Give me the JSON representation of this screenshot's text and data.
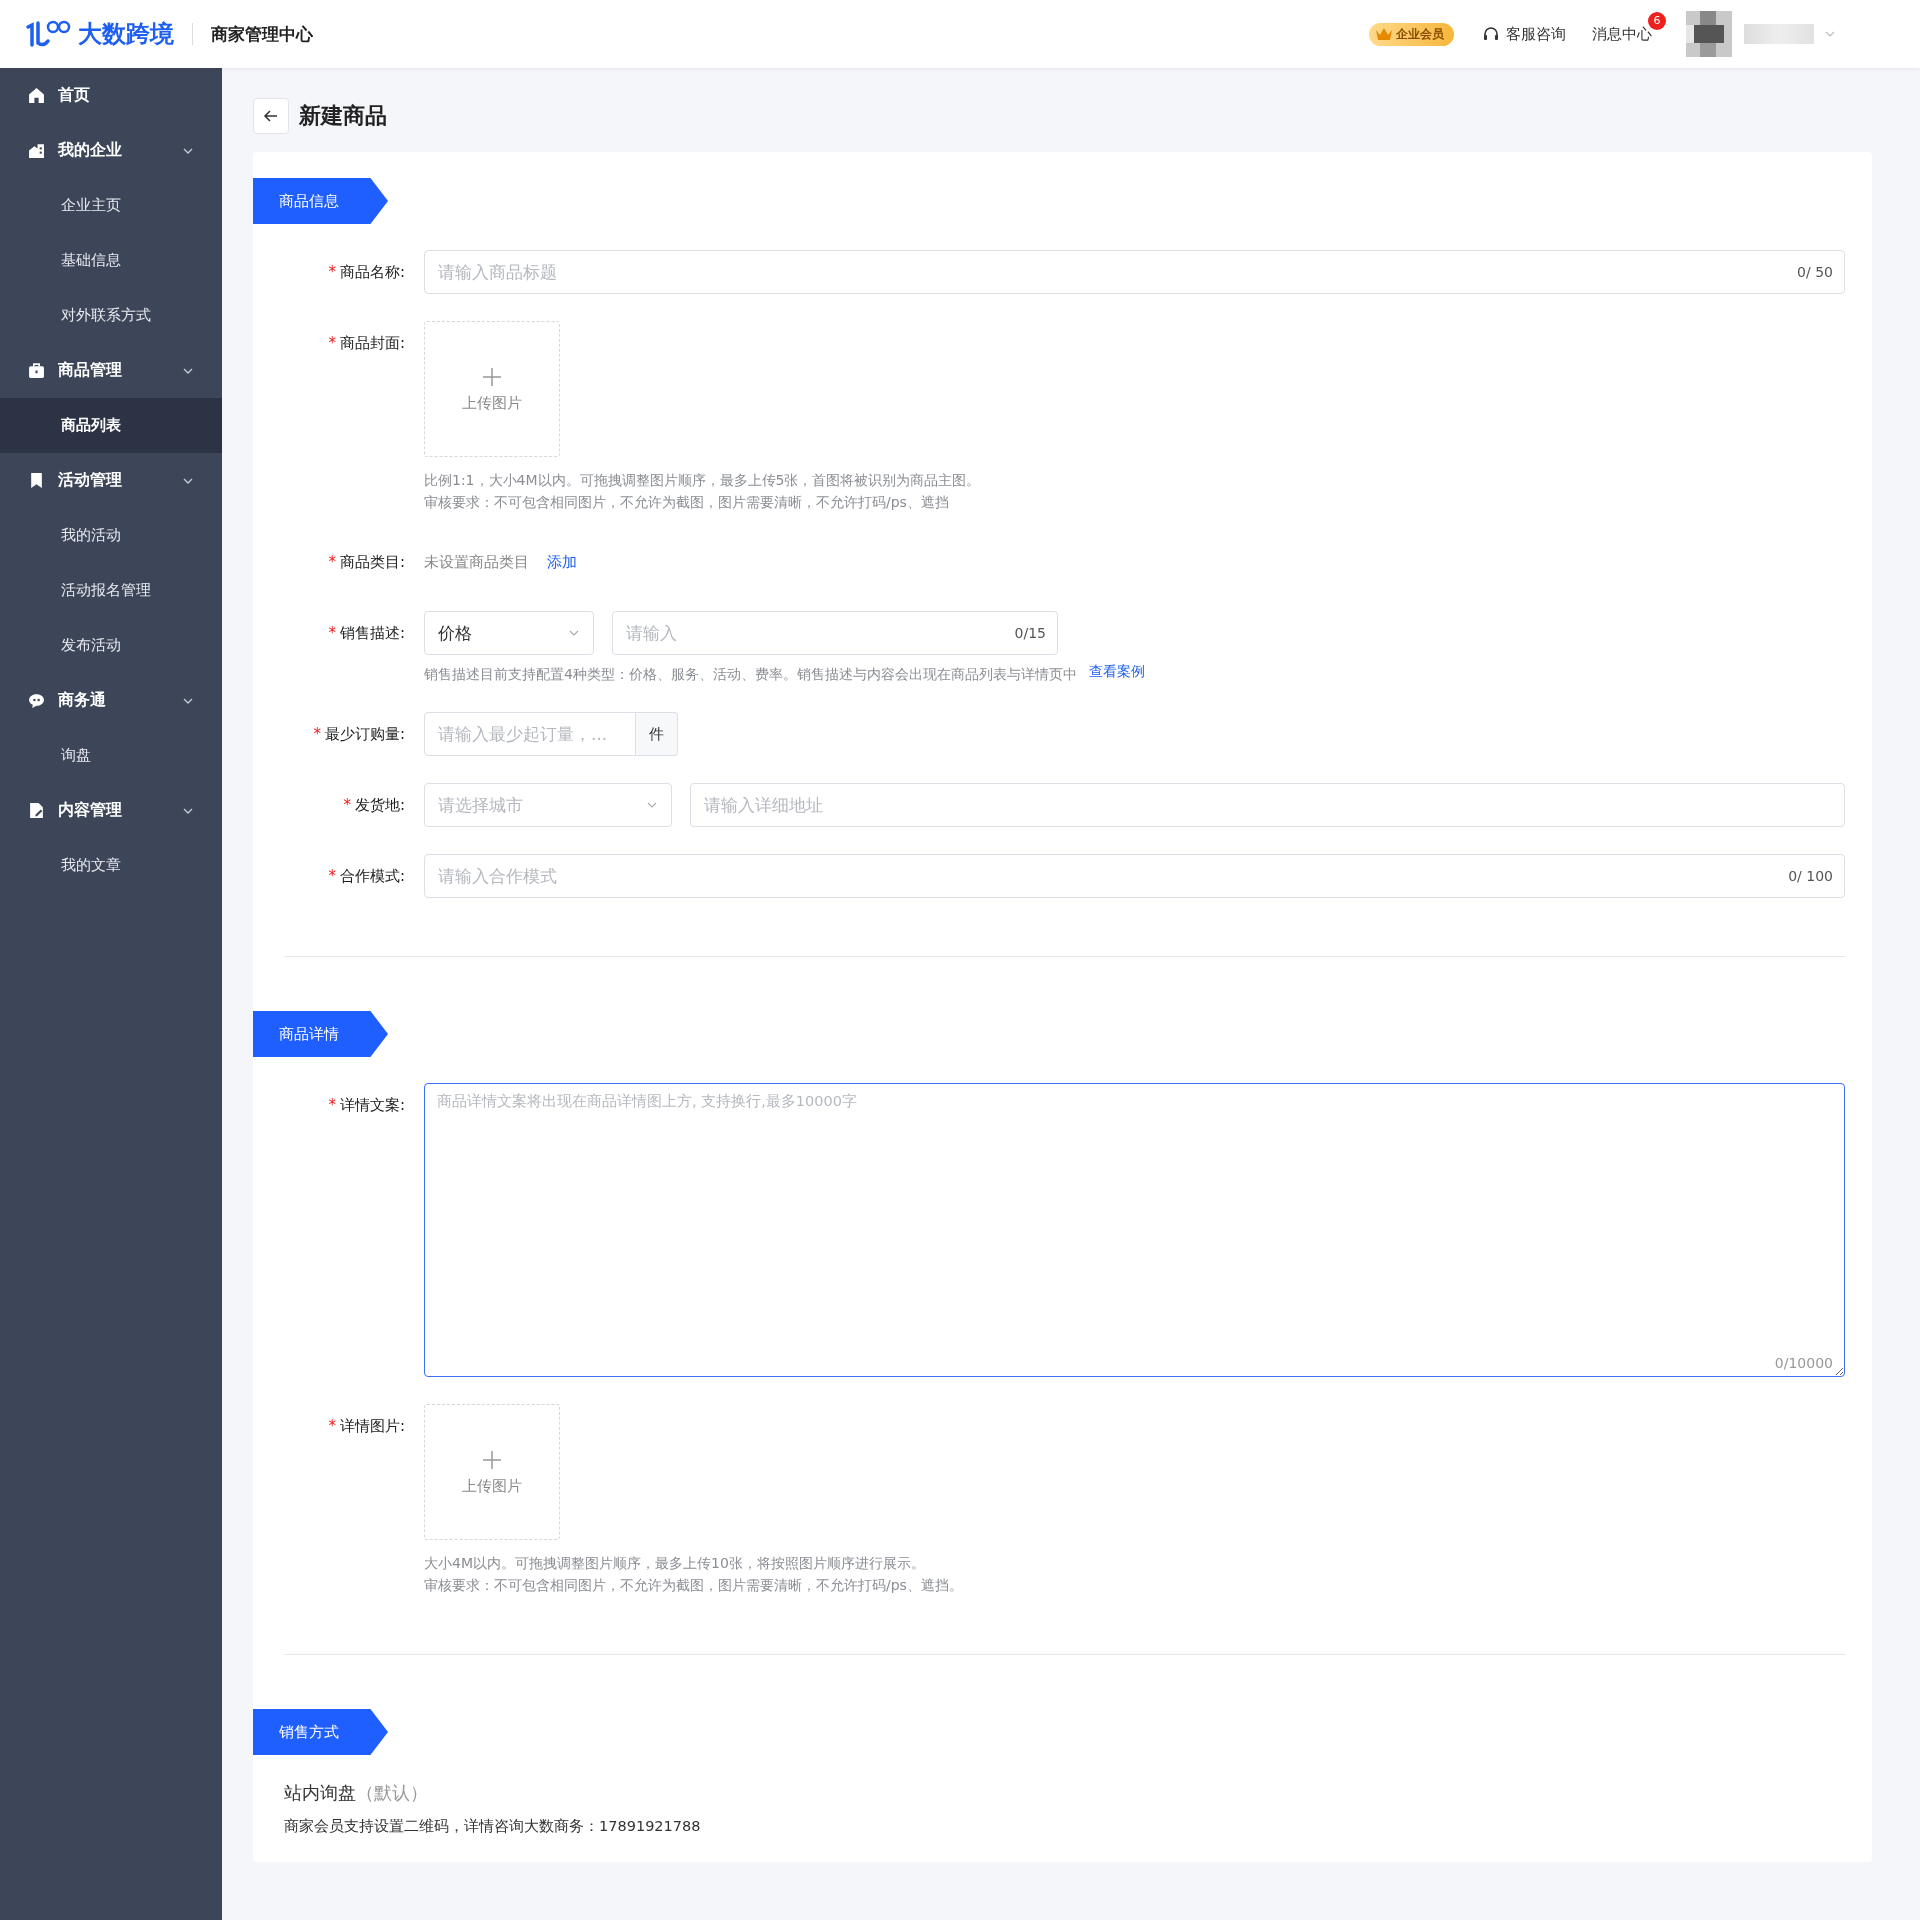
{
  "header": {
    "brand": "大数跨境",
    "app_title": "商家管理中心",
    "vip_badge": "企业会员",
    "support": "客服咨询",
    "messages": {
      "label": "消息中心",
      "badge": "6"
    }
  },
  "sidebar": {
    "groups": [
      {
        "label": "首页"
      },
      {
        "label": "我的企业",
        "expanded": true,
        "children": [
          {
            "label": "企业主页",
            "selected": false
          },
          {
            "label": "基础信息",
            "selected": false
          },
          {
            "label": "对外联系方式",
            "selected": false
          }
        ]
      },
      {
        "label": "商品管理",
        "expanded": true,
        "children": [
          {
            "label": "商品列表",
            "selected": true
          }
        ]
      },
      {
        "label": "活动管理",
        "expanded": true,
        "children": [
          {
            "label": "我的活动",
            "selected": false
          },
          {
            "label": "活动报名管理",
            "selected": false
          },
          {
            "label": "发布活动",
            "selected": false
          }
        ]
      },
      {
        "label": "商务通",
        "expanded": true,
        "children": [
          {
            "label": "询盘",
            "selected": false
          }
        ]
      },
      {
        "label": "内容管理",
        "expanded": true,
        "children": [
          {
            "label": "我的文章",
            "selected": false
          }
        ]
      }
    ]
  },
  "page_title": "新建商品",
  "sections": [
    {
      "title": "商品信息",
      "fields": [
        {
          "kind": "text",
          "mark": "*",
          "label": "商品名称:",
          "placeholder": "请输入商品标题",
          "counter": "0/ 50"
        },
        {
          "kind": "upload",
          "mark": "*",
          "label": "商品封面:",
          "upload_label": "上传图片",
          "hints": [
            "比例1:1，大小4M以内。可拖拽调整图片顺序，最多上传5张，首图将被识别为商品主图。",
            "审核要求：不可包含相同图片，不允许为截图，图片需要清晰，不允许打码/ps、遮挡"
          ]
        },
        {
          "kind": "category",
          "mark": "*",
          "label": "商品类目:",
          "value": "未设置商品类目",
          "link": "添加"
        },
        {
          "kind": "sales",
          "mark": "*",
          "label": "销售描述:",
          "select_value": "价格",
          "placeholder": "请输入",
          "counter": "0/15",
          "hint": "销售描述目前支持配置4种类型：价格、服务、活动、费率。销售描述与内容会出现在商品列表与详情页中",
          "link": "查看案例"
        },
        {
          "kind": "quantity",
          "mark": "*",
          "label": "最少订购量:",
          "placeholder": "请输入最少起订量，...",
          "unit": "件"
        },
        {
          "kind": "address",
          "mark": "*",
          "label": "发货地:",
          "select_placeholder": "请选择城市",
          "placeholder": "请输入详细地址"
        },
        {
          "kind": "text",
          "mark": "*",
          "label": "合作模式:",
          "placeholder": "请输入合作模式",
          "counter": "0/ 100"
        }
      ]
    },
    {
      "title": "商品详情",
      "fields": [
        {
          "kind": "textarea",
          "mark": "*",
          "label": "详情文案:",
          "placeholder": "商品详情文案将出现在商品详情图上方, 支持换行,最多10000字",
          "counter": "0/10000"
        },
        {
          "kind": "upload",
          "mark": "*",
          "label": "详情图片:",
          "upload_label": "上传图片",
          "hints": [
            "大小4M以内。可拖拽调整图片顺序，最多上传10张，将按照图片顺序进行展示。",
            "审核要求：不可包含相同图片，不允许为截图，图片需要清晰，不允许打码/ps、遮挡。"
          ]
        }
      ]
    },
    {
      "title": "销售方式",
      "fields": [
        {
          "kind": "info",
          "method": "站内询盘",
          "tag": "（默认）",
          "note": "商家会员支持设置二维码，详情咨询大数商务：17891921788"
        }
      ]
    }
  ]
}
